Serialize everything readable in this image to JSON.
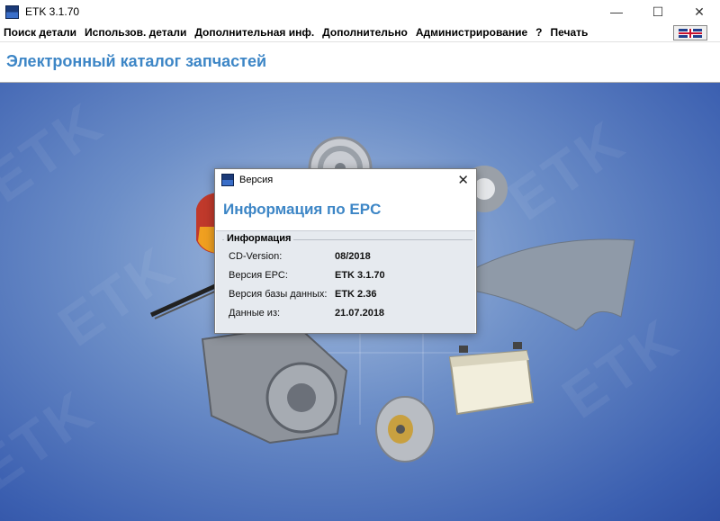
{
  "window": {
    "title": "ETK 3.1.70",
    "controls": {
      "minimize": "—",
      "maximize": "☐",
      "close": "✕"
    }
  },
  "menu": {
    "items": [
      "Поиск детали",
      "Использов. детали",
      "Дополнительная инф.",
      "Дополнительно",
      "Администрирование",
      "?",
      "Печать"
    ],
    "language_flag": "uk-flag-icon"
  },
  "header": {
    "title": "Электронный каталог запчастей"
  },
  "dialog": {
    "title": "Версия",
    "close": "✕",
    "heading": "Информация по EPC",
    "group_label": "Информация",
    "rows": [
      {
        "key": "CD-Version:",
        "value": "08/2018"
      },
      {
        "key": "Версия EPC:",
        "value": "ETK 3.1.70"
      },
      {
        "key": "Версия базы данных:",
        "value": "ETK 2.36"
      },
      {
        "key": "Данные из:",
        "value": "21.07.2018"
      }
    ]
  },
  "colors": {
    "accent": "#3d86c6",
    "background": "#4a6fb8"
  }
}
